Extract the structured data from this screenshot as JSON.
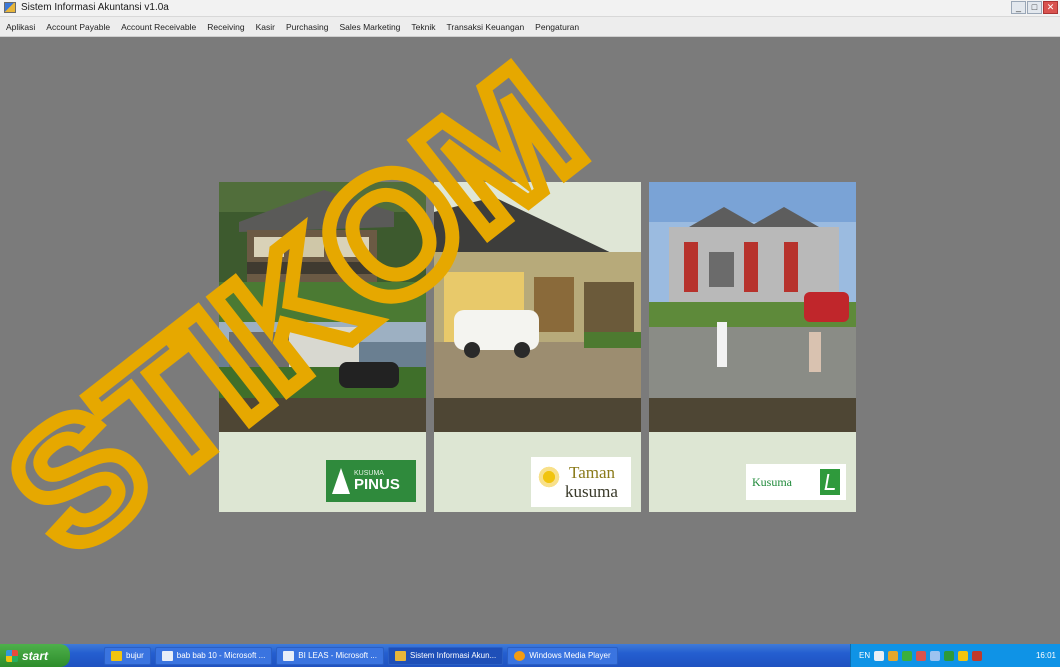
{
  "window": {
    "title": "Sistem Informasi Akuntansi v1.0a",
    "controls": [
      "minimize-icon",
      "maximize-icon",
      "close-icon"
    ]
  },
  "menu": {
    "items": [
      "Aplikasi",
      "Account Payable",
      "Account Receivable",
      "Receiving",
      "Kasir",
      "Purchasing",
      "Sales Marketing",
      "Teknik",
      "Transaksi Keuangan",
      "Pengaturan"
    ]
  },
  "panels": [
    {
      "logo": "KUSUMA PINUS",
      "logo_small": "KUSUMA",
      "logo_big": "PINUS"
    },
    {
      "logo": "Taman kusuma",
      "line1": "Taman",
      "line2": "kusuma"
    },
    {
      "logo": "Kusuma",
      "text": "Kusuma"
    }
  ],
  "taskbar": {
    "start_label": "start",
    "tasks": [
      {
        "label": "bujur",
        "active": false
      },
      {
        "label": "bab bab 10 - Microsoft ...",
        "active": false
      },
      {
        "label": "BI LEAS - Microsoft ...",
        "active": false
      },
      {
        "label": "Sistem Informasi Akun...",
        "active": true
      },
      {
        "label": "Windows Media Player",
        "active": false
      }
    ],
    "tray_lang": "EN",
    "clock": "16:01"
  },
  "watermark": {
    "text": "STIKOM",
    "color": "#e6a800"
  },
  "colors": {
    "background": "#7b7b7b",
    "panel_band": "#4e4634",
    "panel_lower": "#dde6d3"
  }
}
